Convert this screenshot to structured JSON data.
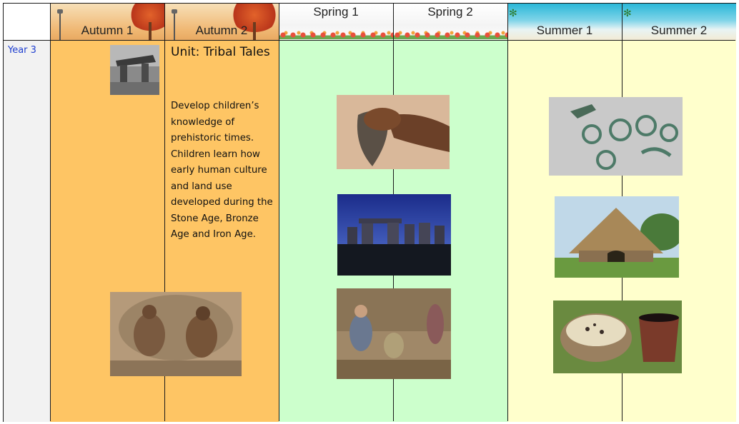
{
  "headers": [
    "Autumn 1",
    "Autumn 2",
    "Spring 1",
    "Spring 2",
    "Summer 1",
    "Summer 2"
  ],
  "rows": [
    {
      "year": "Year 3",
      "unit_title": "Unit: Tribal Tales",
      "description": "Develop children’s knowledge of prehistoric times. Children learn how early human culture and land use developed during the Stone Age, Bronze Age and Iron Age."
    }
  ],
  "colors": {
    "autumn": "#fec564",
    "spring": "#ccffcc",
    "summer": "#ffffcc",
    "year_label": "#1f3fd0"
  }
}
